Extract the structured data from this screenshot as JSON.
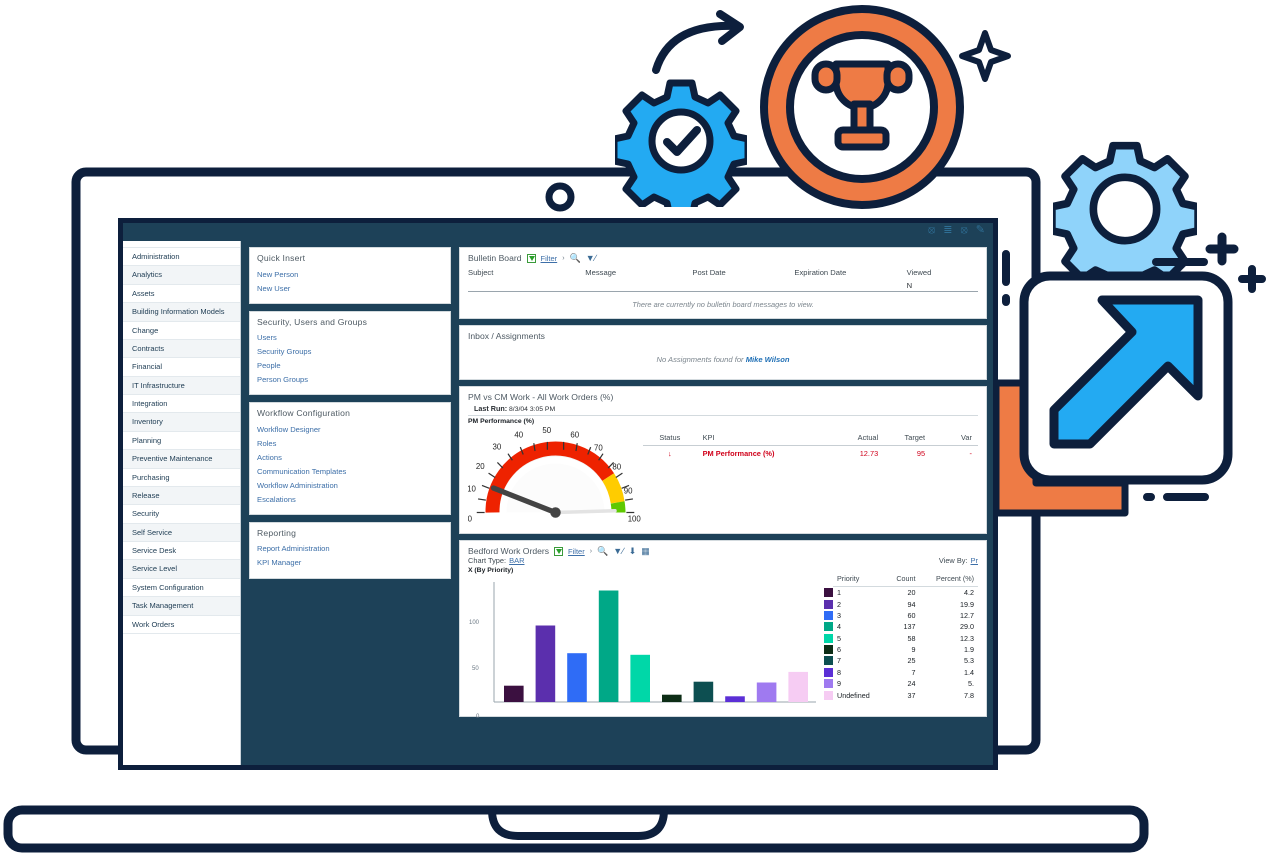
{
  "window": {
    "topbar_icons": [
      "help-icon",
      "filter-sort-icon",
      "info-icon",
      "pencil-icon"
    ]
  },
  "sidebar": {
    "items": [
      {
        "label": "Administration"
      },
      {
        "label": "Analytics"
      },
      {
        "label": "Assets"
      },
      {
        "label": "Building Information Models"
      },
      {
        "label": "Change"
      },
      {
        "label": "Contracts"
      },
      {
        "label": "Financial"
      },
      {
        "label": "IT Infrastructure"
      },
      {
        "label": "Integration"
      },
      {
        "label": "Inventory"
      },
      {
        "label": "Planning"
      },
      {
        "label": "Preventive Maintenance"
      },
      {
        "label": "Purchasing"
      },
      {
        "label": "Release"
      },
      {
        "label": "Security"
      },
      {
        "label": "Self Service"
      },
      {
        "label": "Service Desk"
      },
      {
        "label": "Service Level"
      },
      {
        "label": "System Configuration"
      },
      {
        "label": "Task Management"
      },
      {
        "label": "Work Orders"
      }
    ]
  },
  "cards": [
    {
      "title": "Quick Insert",
      "links": [
        "New Person",
        "New User"
      ]
    },
    {
      "title": "Security, Users and Groups",
      "links": [
        "Users",
        "Security Groups",
        "People",
        "Person Groups"
      ]
    },
    {
      "title": "Workflow Configuration",
      "links": [
        "Workflow Designer",
        "Roles",
        "Actions",
        "Communication Templates",
        "Workflow Administration",
        "Escalations"
      ]
    },
    {
      "title": "Reporting",
      "links": [
        "Report Administration",
        "KPI Manager"
      ]
    }
  ],
  "bulletin": {
    "title": "Bulletin Board",
    "filter_label": "Filter",
    "chevron": "›",
    "toolbar_icons": [
      "search-icon",
      "clear-filter-icon"
    ],
    "columns": [
      "Subject",
      "Message",
      "Post Date",
      "Expiration Date",
      "Viewed"
    ],
    "row": {
      "subject": "",
      "message": "",
      "post_date": "",
      "expiration_date": "",
      "viewed": "N"
    },
    "empty_message": "There are currently no bulletin board messages to view."
  },
  "inbox": {
    "title": "Inbox / Assignments",
    "empty_prefix": "No Assignments found for ",
    "user": "Mike Wilson"
  },
  "kpi_panel": {
    "title": "PM vs CM Work - All Work Orders (%)",
    "last_run_label": "Last Run:",
    "last_run_value": "8/3/04 3:05 PM",
    "axis_label": "PM Performance (%)",
    "columns": [
      "Status",
      "KPI",
      "Actual",
      "Target",
      "Var"
    ],
    "row": {
      "status": "↓",
      "kpi": "PM Performance (%)",
      "actual": "12.73",
      "target": "95",
      "variance": "-"
    },
    "gauge": {
      "value": 12.73,
      "min": 0,
      "max": 100,
      "ticks": [
        "0",
        "10",
        "20",
        "30",
        "40",
        "50",
        "60",
        "70",
        "80",
        "90",
        "100"
      ],
      "bands": [
        {
          "from": 0,
          "to": 80,
          "color": "#ee2200"
        },
        {
          "from": 80,
          "to": 92,
          "color": "#ffcc00"
        },
        {
          "from": 92,
          "to": 100,
          "color": "#5ec800"
        }
      ]
    }
  },
  "chart_panel": {
    "title": "Bedford Work Orders",
    "filter_label": "Filter",
    "chevron": "›",
    "toolbar_icons": [
      "search-icon",
      "clear-filter-icon",
      "download-icon",
      "table-view-icon"
    ],
    "chart_type_label": "Chart Type:",
    "chart_type_value": "BAR",
    "view_by_label": "View By:",
    "view_by_value": "Pr",
    "axis_label": "X (By Priority)"
  },
  "chart_data": {
    "type": "bar",
    "title": "Bedford Work Orders",
    "xlabel": "X (By Priority)",
    "ylabel": "",
    "ylim": [
      0,
      145
    ],
    "yticks": [
      0,
      50,
      100
    ],
    "grid": false,
    "legend_position": "right",
    "categories": [
      "1",
      "2",
      "3",
      "4",
      "5",
      "6",
      "7",
      "8",
      "9",
      "Undefined"
    ],
    "values": [
      20,
      94,
      60,
      137,
      58,
      9,
      25,
      7,
      24,
      37
    ],
    "percents": [
      "4.2",
      "19.9",
      "12.7",
      "29.0",
      "12.3",
      "1.9",
      "5.3",
      "1.4",
      "5.",
      "7.8"
    ],
    "colors": [
      "#3b1040",
      "#5b2fad",
      "#2f6cf6",
      "#00a887",
      "#00d7a8",
      "#0d2d16",
      "#0d4f51",
      "#5b2fd6",
      "#9f7af0",
      "#f6ccf3"
    ],
    "legend_columns": [
      "Priority",
      "Count",
      "Percent (%)"
    ]
  }
}
